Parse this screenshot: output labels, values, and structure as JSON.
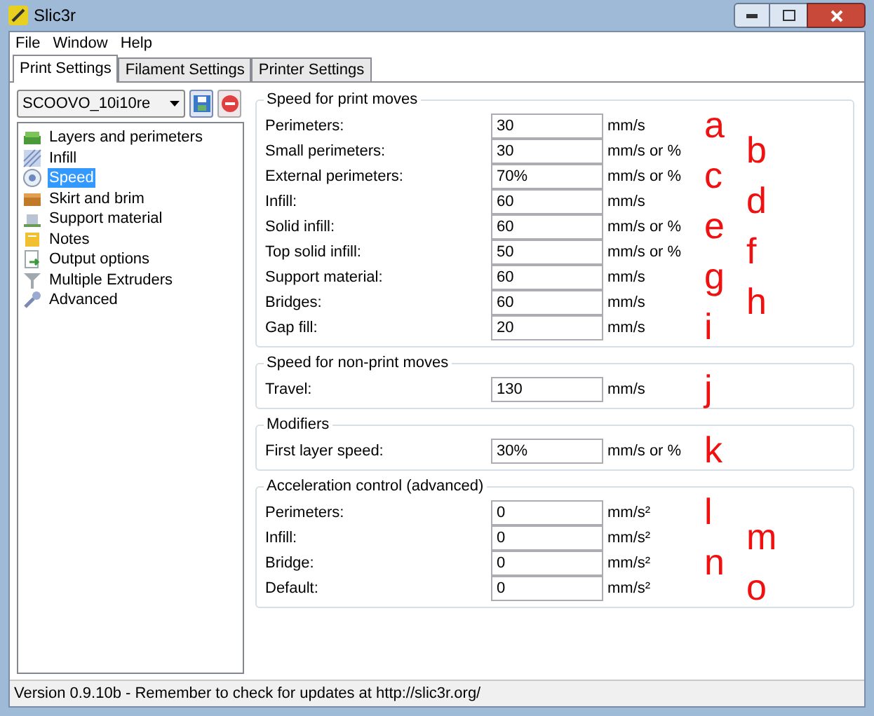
{
  "window": {
    "title": "Slic3r"
  },
  "menu": [
    "File",
    "Window",
    "Help"
  ],
  "tabs": [
    {
      "label": "Print Settings",
      "selected": true
    },
    {
      "label": "Filament Settings",
      "selected": false
    },
    {
      "label": "Printer Settings",
      "selected": false
    }
  ],
  "preset": {
    "value": "SCOOVO_10i10re"
  },
  "sidebar": {
    "items": [
      {
        "label": "Layers and perimeters",
        "selected": false
      },
      {
        "label": "Infill",
        "selected": false
      },
      {
        "label": "Speed",
        "selected": true
      },
      {
        "label": "Skirt and brim",
        "selected": false
      },
      {
        "label": "Support material",
        "selected": false
      },
      {
        "label": "Notes",
        "selected": false
      },
      {
        "label": "Output options",
        "selected": false
      },
      {
        "label": "Multiple Extruders",
        "selected": false
      },
      {
        "label": "Advanced",
        "selected": false
      }
    ]
  },
  "groups": [
    {
      "title": "Speed for print moves",
      "rows": [
        {
          "label": "Perimeters:",
          "value": "30",
          "unit": "mm/s",
          "annotation": "a"
        },
        {
          "label": "Small perimeters:",
          "value": "30",
          "unit": "mm/s or %",
          "annotation": "b"
        },
        {
          "label": "External perimeters:",
          "value": "70%",
          "unit": "mm/s or %",
          "annotation": "c"
        },
        {
          "label": "Infill:",
          "value": "60",
          "unit": "mm/s",
          "annotation": "d"
        },
        {
          "label": "Solid infill:",
          "value": "60",
          "unit": "mm/s or %",
          "annotation": "e"
        },
        {
          "label": "Top solid infill:",
          "value": "50",
          "unit": "mm/s or %",
          "annotation": "f"
        },
        {
          "label": "Support material:",
          "value": "60",
          "unit": "mm/s",
          "annotation": "g"
        },
        {
          "label": "Bridges:",
          "value": "60",
          "unit": "mm/s",
          "annotation": "h"
        },
        {
          "label": "Gap fill:",
          "value": "20",
          "unit": "mm/s",
          "annotation": "i"
        }
      ]
    },
    {
      "title": "Speed for non-print moves",
      "rows": [
        {
          "label": "Travel:",
          "value": "130",
          "unit": "mm/s",
          "annotation": "j"
        }
      ]
    },
    {
      "title": "Modifiers",
      "rows": [
        {
          "label": "First layer speed:",
          "value": "30%",
          "unit": "mm/s or %",
          "annotation": "k"
        }
      ]
    },
    {
      "title": "Acceleration control (advanced)",
      "rows": [
        {
          "label": "Perimeters:",
          "value": "0",
          "unit": "mm/s²",
          "annotation": "l"
        },
        {
          "label": "Infill:",
          "value": "0",
          "unit": "mm/s²",
          "annotation": "m"
        },
        {
          "label": "Bridge:",
          "value": "0",
          "unit": "mm/s²",
          "annotation": "n"
        },
        {
          "label": "Default:",
          "value": "0",
          "unit": "mm/s²",
          "annotation": "o"
        }
      ]
    }
  ],
  "status_bar": "Version 0.9.10b - Remember to check for updates at http://slic3r.org/"
}
